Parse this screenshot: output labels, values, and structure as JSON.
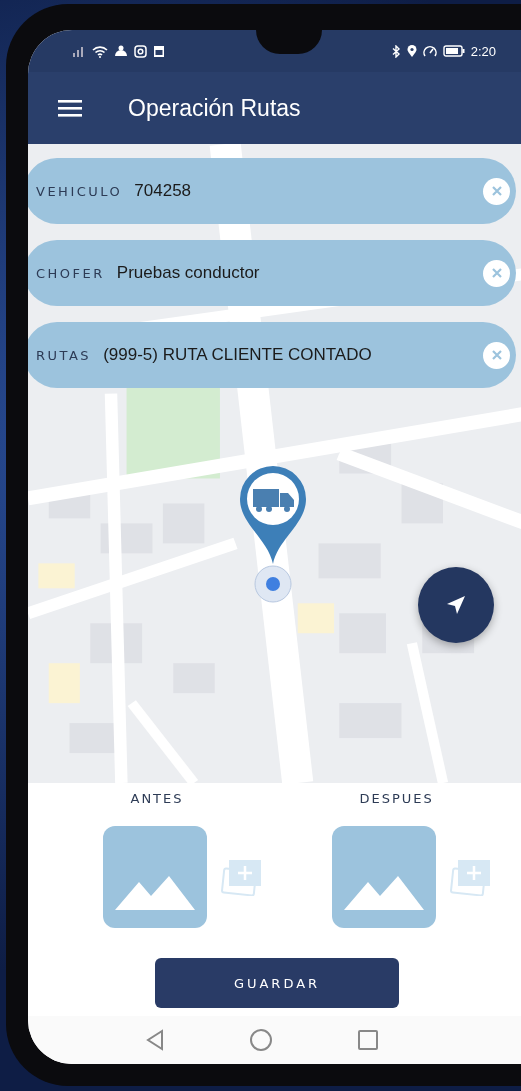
{
  "status_bar": {
    "time": "2:20"
  },
  "app_bar": {
    "title": "Operación Rutas"
  },
  "filters": [
    {
      "label": "VEHICULO",
      "value": "704258"
    },
    {
      "label": "CHOFER",
      "value": "Pruebas conductor"
    },
    {
      "label": "RUTAS",
      "value": "(999-5) RUTA CLIENTE CONTADO"
    }
  ],
  "photos": [
    {
      "label": "ANTES"
    },
    {
      "label": "DESPUES"
    }
  ],
  "save_button": {
    "label": "GUARDAR"
  }
}
